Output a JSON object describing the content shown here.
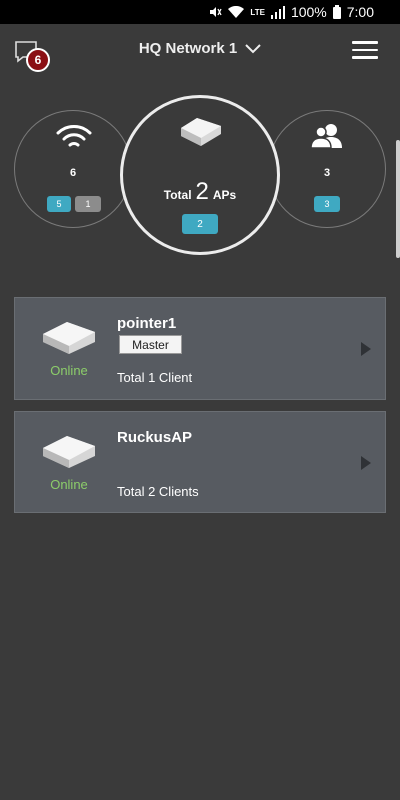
{
  "statusbar": {
    "battery_text": "100%",
    "time": "7:00",
    "network_label": "LTE"
  },
  "header": {
    "title": "HQ Network 1",
    "message_badge": "6"
  },
  "summary": {
    "wireless": {
      "count": "6",
      "pills": [
        "5",
        "1"
      ]
    },
    "aps": {
      "total_label": "Total",
      "total_count": "2",
      "unit_label": "APs",
      "pill": "2"
    },
    "clients": {
      "count": "3",
      "pill": "3"
    }
  },
  "aps": [
    {
      "name": "pointer1",
      "role": "Master",
      "status": "Online",
      "clients": "Total 1 Client"
    },
    {
      "name": "RuckusAP",
      "status": "Online",
      "clients": "Total 2 Clients"
    }
  ],
  "colors": {
    "accent_blue": "#3fa9c2",
    "online_green": "#8ccd6a",
    "badge_red": "#8b0f14"
  }
}
